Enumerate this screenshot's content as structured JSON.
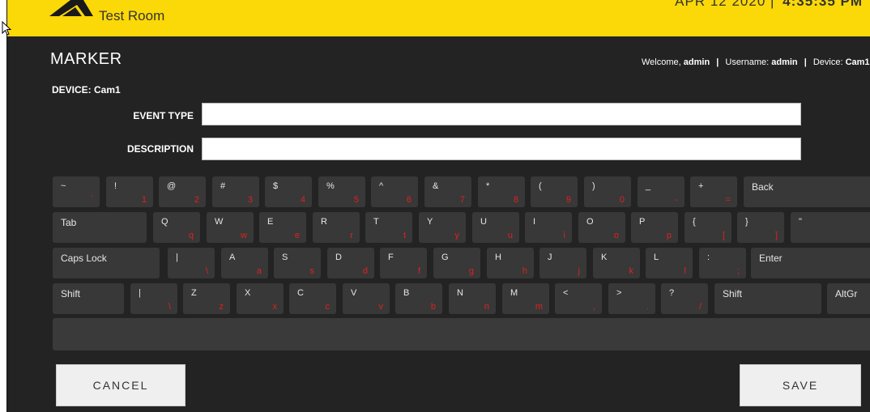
{
  "header": {
    "room": "Test Room",
    "date": "APR 12 2020",
    "date_separator": "|",
    "time": "4:35:35 PM"
  },
  "page": {
    "title": "MARKER",
    "welcome_prefix": "Welcome,",
    "welcome_user": "admin",
    "username_label": "Username:",
    "username": "admin",
    "device_label": "Device:",
    "device": "Cam1",
    "device_heading": "DEVICE: Cam1"
  },
  "form": {
    "event_type_label": "EVENT TYPE",
    "event_type_value": "",
    "description_label": "DESCRIPTION",
    "description_value": ""
  },
  "keyboard": {
    "rows": [
      [
        {
          "top": "~",
          "bottom": "`"
        },
        {
          "top": "!",
          "bottom": "1"
        },
        {
          "top": "@",
          "bottom": "2"
        },
        {
          "top": "#",
          "bottom": "3"
        },
        {
          "top": "$",
          "bottom": "4"
        },
        {
          "top": "%",
          "bottom": "5"
        },
        {
          "top": "^",
          "bottom": "6"
        },
        {
          "top": "&",
          "bottom": "7"
        },
        {
          "top": "*",
          "bottom": "8"
        },
        {
          "top": "(",
          "bottom": "9"
        },
        {
          "top": ")",
          "bottom": "0"
        },
        {
          "top": "_",
          "bottom": "-"
        },
        {
          "top": "+",
          "bottom": "="
        },
        {
          "top": "Back",
          "bottom": ""
        }
      ],
      [
        {
          "top": "Tab",
          "bottom": ""
        },
        {
          "top": "Q",
          "bottom": "q"
        },
        {
          "top": "W",
          "bottom": "w"
        },
        {
          "top": "E",
          "bottom": "e"
        },
        {
          "top": "R",
          "bottom": "r"
        },
        {
          "top": "T",
          "bottom": "t"
        },
        {
          "top": "Y",
          "bottom": "y"
        },
        {
          "top": "U",
          "bottom": "u"
        },
        {
          "top": "I",
          "bottom": "i"
        },
        {
          "top": "O",
          "bottom": "o"
        },
        {
          "top": "P",
          "bottom": "p"
        },
        {
          "top": "{",
          "bottom": "["
        },
        {
          "top": "}",
          "bottom": "]"
        },
        {
          "top": "\"",
          "bottom": "'"
        }
      ],
      [
        {
          "top": "Caps Lock",
          "bottom": ""
        },
        {
          "top": "|",
          "bottom": "\\"
        },
        {
          "top": "A",
          "bottom": "a"
        },
        {
          "top": "S",
          "bottom": "s"
        },
        {
          "top": "D",
          "bottom": "d"
        },
        {
          "top": "F",
          "bottom": "f"
        },
        {
          "top": "G",
          "bottom": "g"
        },
        {
          "top": "H",
          "bottom": "h"
        },
        {
          "top": "J",
          "bottom": "j"
        },
        {
          "top": "K",
          "bottom": "k"
        },
        {
          "top": "L",
          "bottom": "l"
        },
        {
          "top": ":",
          "bottom": ";"
        },
        {
          "top": "Enter",
          "bottom": ""
        }
      ],
      [
        {
          "top": "Shift",
          "bottom": ""
        },
        {
          "top": "|",
          "bottom": "\\"
        },
        {
          "top": "Z",
          "bottom": "z"
        },
        {
          "top": "X",
          "bottom": "x"
        },
        {
          "top": "C",
          "bottom": "c"
        },
        {
          "top": "V",
          "bottom": "v"
        },
        {
          "top": "B",
          "bottom": "b"
        },
        {
          "top": "N",
          "bottom": "n"
        },
        {
          "top": "M",
          "bottom": "m"
        },
        {
          "top": "<",
          "bottom": ","
        },
        {
          "top": ">",
          "bottom": "."
        },
        {
          "top": "?",
          "bottom": "/"
        },
        {
          "top": "Shift",
          "bottom": ""
        },
        {
          "top": "AltGr",
          "bottom": ""
        }
      ]
    ]
  },
  "actions": {
    "cancel": "CANCEL",
    "save": "SAVE"
  },
  "colors": {
    "header_bg": "#fbd808",
    "page_bg": "#232323",
    "key_bg": "#383838",
    "key_secondary": "#e02020"
  },
  "icons": {
    "logo": "brand-logo-icon",
    "cursor": "mouse-pointer-icon"
  }
}
